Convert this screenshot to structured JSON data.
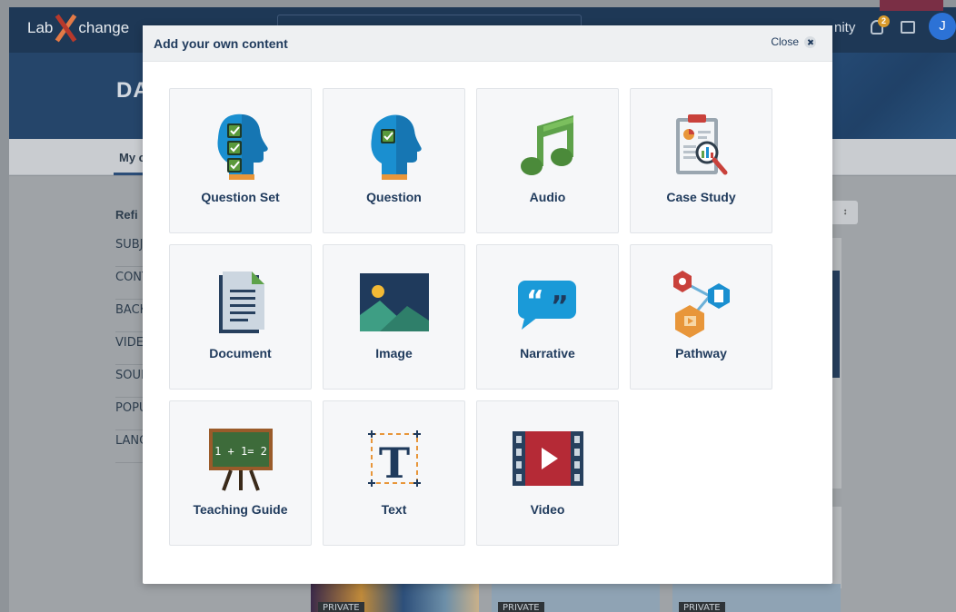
{
  "background": {
    "logo_text_left": "Lab",
    "logo_text_right": "change",
    "nav_partial": "nity",
    "notification_count": "2",
    "avatar_initial": "J",
    "hero_text_partial": "DA",
    "tab_partial": "My c",
    "refine_partial": "Refi",
    "filters": [
      "SUBJ",
      "CONT",
      "BACK",
      "VIDE",
      "SOUR",
      "POPU",
      "LANG"
    ],
    "private_tags": [
      "PRIVATE",
      "PRIVATE",
      "PRIVATE"
    ]
  },
  "modal": {
    "title": "Add your own content",
    "close_label": "Close",
    "tiles": [
      {
        "label": "Question Set",
        "icon": "question-set-icon"
      },
      {
        "label": "Question",
        "icon": "question-icon"
      },
      {
        "label": "Audio",
        "icon": "music-note-icon"
      },
      {
        "label": "Case Study",
        "icon": "case-study-clipboard-icon"
      },
      {
        "label": "Document",
        "icon": "document-icon"
      },
      {
        "label": "Image",
        "icon": "image-landscape-icon"
      },
      {
        "label": "Narrative",
        "icon": "quote-bubble-icon"
      },
      {
        "label": "Pathway",
        "icon": "pathway-hexagons-icon"
      },
      {
        "label": "Teaching Guide",
        "icon": "chalkboard-icon"
      },
      {
        "label": "Text",
        "icon": "text-t-icon"
      },
      {
        "label": "Video",
        "icon": "video-film-icon"
      }
    ],
    "chalkboard_text": "1 + 1= 2"
  },
  "colors": {
    "heading_navy": "#1f3a5c",
    "head_blue": "#1a8fd0",
    "check_green": "#5a9a3c",
    "audio_green": "#5ea24a",
    "video_red": "#b52a36",
    "pathway_orange": "#e8963a"
  }
}
